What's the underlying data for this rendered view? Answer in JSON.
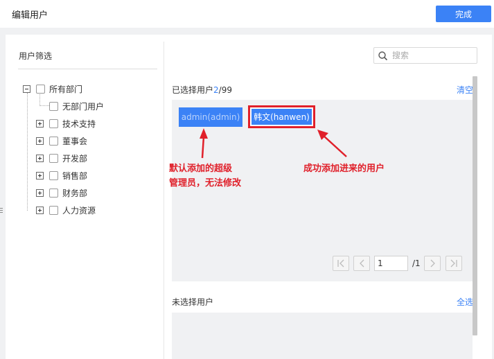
{
  "header": {
    "title": "编辑用户",
    "done_label": "完成"
  },
  "filter": {
    "title": "用户筛选",
    "tree": [
      {
        "label": "所有部门",
        "expander": "minus"
      },
      {
        "label": "无部门用户",
        "expander": "none"
      },
      {
        "label": "技术支持",
        "expander": "plus"
      },
      {
        "label": "董事会",
        "expander": "plus"
      },
      {
        "label": "开发部",
        "expander": "plus"
      },
      {
        "label": "销售部",
        "expander": "plus"
      },
      {
        "label": "财务部",
        "expander": "plus"
      },
      {
        "label": "人力资源",
        "expander": "plus"
      }
    ]
  },
  "search": {
    "placeholder": "搜索",
    "icon": "search-icon"
  },
  "selected": {
    "title_prefix": "已选择用户",
    "count": "2",
    "total": "/99",
    "clear_label": "清空",
    "users": [
      {
        "label": "admin(admin)"
      },
      {
        "label": "韩文(hanwen)"
      }
    ]
  },
  "annotations": {
    "left_line1": "默认添加的超级",
    "left_line2": "管理员，无法修改",
    "right": "成功添加进来的用户",
    "color": "#e0202a"
  },
  "pagination": {
    "page": "1",
    "total_label": "/1"
  },
  "unselected": {
    "title": "未选择用户",
    "select_all_label": "全选"
  },
  "colors": {
    "accent": "#3b82f6",
    "annotation": "#e0202a"
  }
}
